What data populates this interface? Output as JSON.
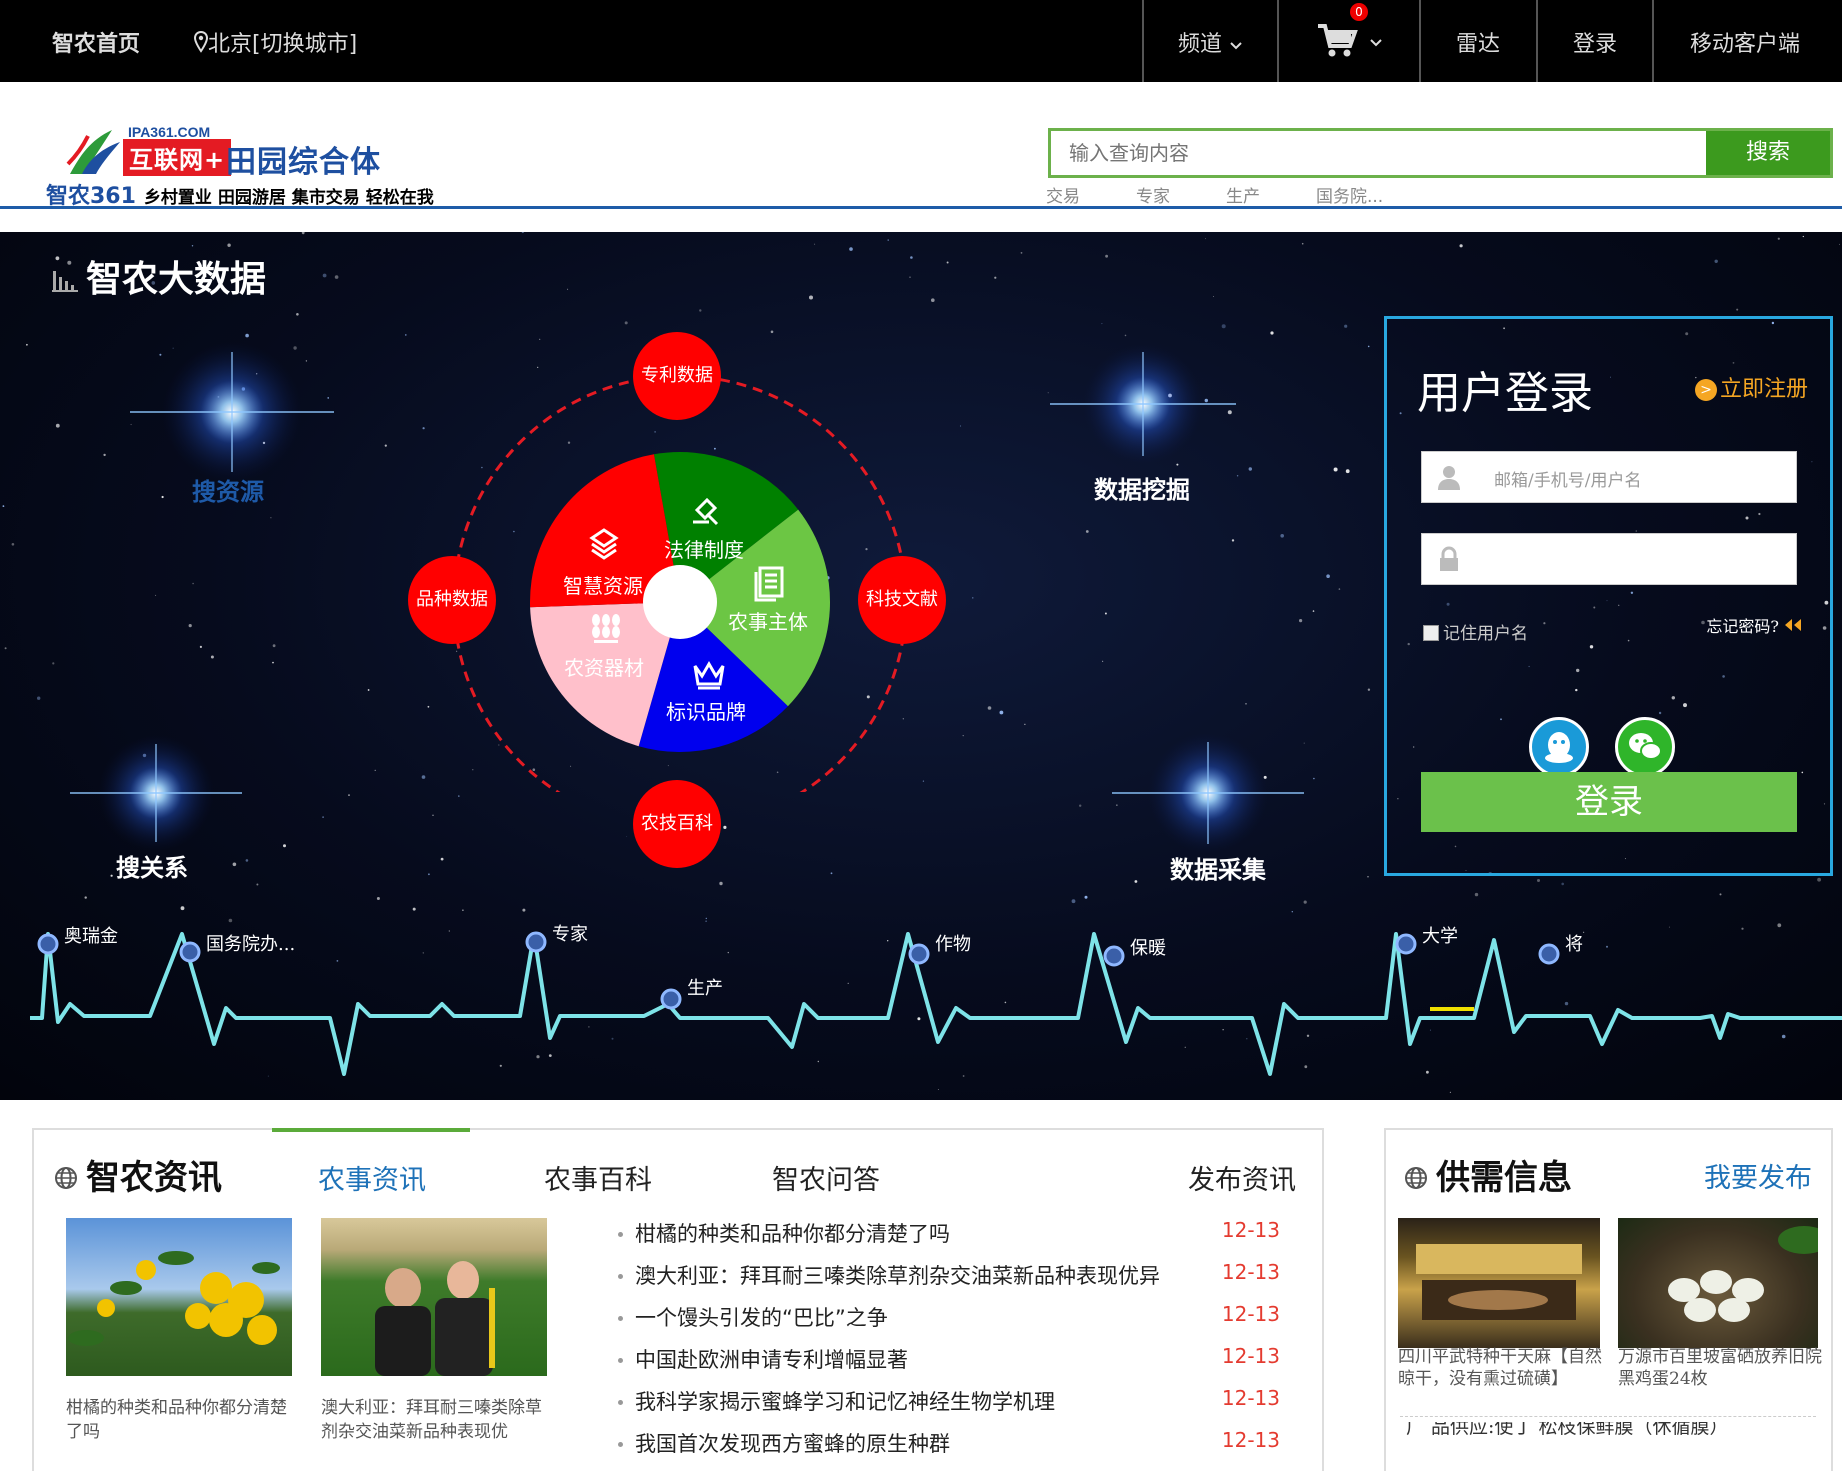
{
  "topbar": {
    "home": "智农首页",
    "location": "北京[切换城市]",
    "channel": "频道",
    "cart_count": "0",
    "radar": "雷达",
    "login": "登录",
    "mobile": "移动客户端"
  },
  "logo": {
    "domain": "IPA361.COM",
    "red_text": "互联网+",
    "blue_text": "田园综合体",
    "brand": "智农361",
    "slogan": "乡村置业 田园游居 集市交易 轻松在我"
  },
  "search": {
    "placeholder": "输入查询内容",
    "button": "搜索",
    "hot": [
      "交易",
      "专家",
      "生产",
      "国务院..."
    ]
  },
  "bigdata": {
    "title": "智农大数据",
    "stars": {
      "search_resource": "搜资源",
      "data_mining": "数据挖掘",
      "search_relation": "搜关系",
      "data_collection": "数据采集"
    },
    "outer_nodes": {
      "top": "专利数据",
      "left": "品种数据",
      "right": "科技文献",
      "bottom": "农技百科"
    },
    "wheel": {
      "law": "法律制度",
      "smart": "智慧资源",
      "entity": "农事主体",
      "material": "农资器材",
      "brand": "标识品牌"
    },
    "colors": {
      "law": "#008000",
      "smart": "#ff0000",
      "entity": "#6cc644",
      "material": "#ffc0cb",
      "brand": "#0000ee",
      "wave": "#7ee3e8",
      "login_border": "#29a8e0"
    },
    "wave_labels": [
      "奥瑞金",
      "国务院办...",
      "专家",
      "生产",
      "作物",
      "保暖",
      "大学",
      "将"
    ]
  },
  "login": {
    "title": "用户登录",
    "register": "立即注册",
    "register_icon": ">",
    "user_placeholder": "邮箱/手机号/用户名",
    "remember": "记住用户名",
    "forgot": "忘记密码?",
    "button": "登录"
  },
  "news": {
    "title": "智农资讯",
    "tabs": [
      "农事资讯",
      "农事百科",
      "智农问答"
    ],
    "publish": "发布资讯",
    "thumbs": [
      {
        "caption": "柑橘的种类和品种你都分清楚了吗"
      },
      {
        "caption": "澳大利亚：拜耳耐三嗪类除草剂杂交油菜新品种表现优"
      }
    ],
    "items": [
      {
        "title": "柑橘的种类和品种你都分清楚了吗",
        "date": "12-13"
      },
      {
        "title": "澳大利亚：拜耳耐三嗪类除草剂杂交油菜新品种表现优异",
        "date": "12-13"
      },
      {
        "title": "一个馒头引发的“巴比”之争",
        "date": "12-13"
      },
      {
        "title": "中国赴欧洲申请专利增幅显著",
        "date": "12-13"
      },
      {
        "title": "我科学家揭示蜜蜂学习和记忆神经生物学机理",
        "date": "12-13"
      },
      {
        "title": "我国首次发现西方蜜蜂的原生种群",
        "date": "12-13"
      }
    ]
  },
  "supply": {
    "title": "供需信息",
    "publish": "我要发布",
    "thumbs": [
      {
        "caption": "四川平武特种干天麻【自然晾干，没有熏过硫磺】"
      },
      {
        "caption": "万源市百里坡富硒放养旧院黑鸡蛋24枚"
      }
    ],
    "partial_line": "广 品供应:使丁 松枝保鲜膜（休循膜）"
  }
}
